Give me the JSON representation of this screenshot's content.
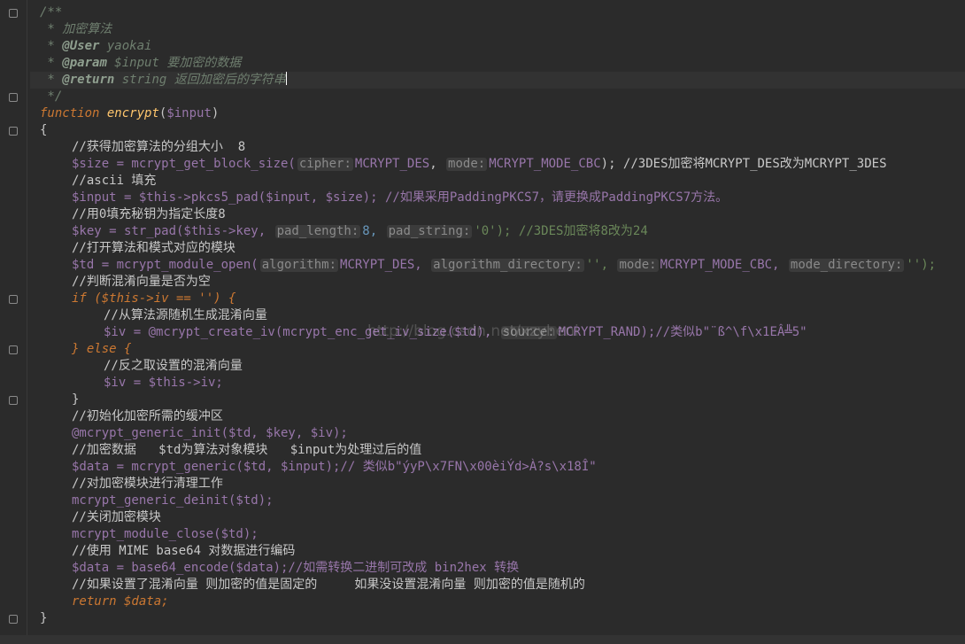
{
  "code": {
    "l1": "/**",
    "l2": " * 加密算法",
    "l3_star": " * ",
    "l3_tag": "@User",
    "l3_rest": " yaokai",
    "l4_star": " * ",
    "l4_tag": "@param",
    "l4_rest": " $input 要加密的数据",
    "l5_star": " * ",
    "l5_tag": "@return",
    "l5_rest": " string 返回加密后的字符串",
    "l6": " */",
    "l7_kw": "function",
    "l7_name": "encrypt",
    "l7_p1": "(",
    "l7_var": "$input",
    "l7_p2": ")",
    "l8": "{",
    "l9": "//获得加密算法的分组大小  8",
    "l10": "$size = mcrypt_get_block_size(",
    "l10_h1": "cipher:",
    "l10_c1": "MCRYPT_DES",
    "l10_comma": ", ",
    "l10_h2": "mode:",
    "l10_c2": "MCRYPT_MODE_CBC",
    "l10_end": "); //3DES加密将MCRYPT_DES改为MCRYPT_3DES",
    "l11": "//ascii 填充",
    "l12": "$input = $this->pkcs5_pad($input, $size); //如果采用PaddingPKCS7，请更换成PaddingPKCS7方法。",
    "l13": "//用0填充秘钥为指定长度8",
    "l14_a": "$key = str_pad($this->key, ",
    "l14_h1": "pad_length:",
    "l14_b": "8, ",
    "l14_h2": "pad_string:",
    "l14_c": "'0'); //3DES加密将8改为24",
    "l15": "//打开算法和模式对应的模块",
    "l16_a": "$td = mcrypt_module_open(",
    "l16_h1": "algorithm:",
    "l16_b": "MCRYPT_DES, ",
    "l16_h2": "algorithm_directory:",
    "l16_c": "'', ",
    "l16_h3": "mode:",
    "l16_d": "MCRYPT_MODE_CBC, ",
    "l16_h4": "mode_directory:",
    "l16_e": "'');",
    "l17": "//判断混淆向量是否为空",
    "l18": "if ($this->iv == '') {",
    "l19": "//从算法源随机生成混淆向量",
    "l20_a": "$iv = @mcrypt_create_iv(mcrypt_enc_get_iv_size($td), ",
    "l20_h": "source:",
    "l20_b": "MCRYPT_RAND);//类似b\"¨ß^\\f\\x1EÂ╩5\"",
    "l21": "} else {",
    "l22": "//反之取设置的混淆向量",
    "l23": "$iv = $this->iv;",
    "l24": "}",
    "l25": "//初始化加密所需的缓冲区",
    "l26": "@mcrypt_generic_init($td, $key, $iv);",
    "l27": "//加密数据   $td为算法对象模块   $input为处理过后的值",
    "l28": "$data = mcrypt_generic($td, $input);// 类似b\"ýyP\\x7FN\\x00èiÝd>À?s\\x18Î\"",
    "l29": "//对加密模块进行清理工作",
    "l30": "mcrypt_generic_deinit($td);",
    "l31": "//关闭加密模块",
    "l32": "mcrypt_module_close($td);",
    "l33": "//使用 MIME base64 对数据进行编码",
    "l34": "$data = base64_encode($data);//如需转换二进制可改成 bin2hex 转换",
    "l35": "//如果设置了混淆向量 则加密的值是固定的     如果没设置混淆向量 则加密的值是随机的",
    "l36": "return $data;",
    "l37": "}"
  },
  "watermark": "http://blog.csdn.net/xzyheni",
  "colors": {
    "background": "#2b2b2b",
    "keyword": "#cc7832",
    "variable": "#9876aa",
    "function_name": "#ffc66d",
    "string": "#6a8759"
  }
}
